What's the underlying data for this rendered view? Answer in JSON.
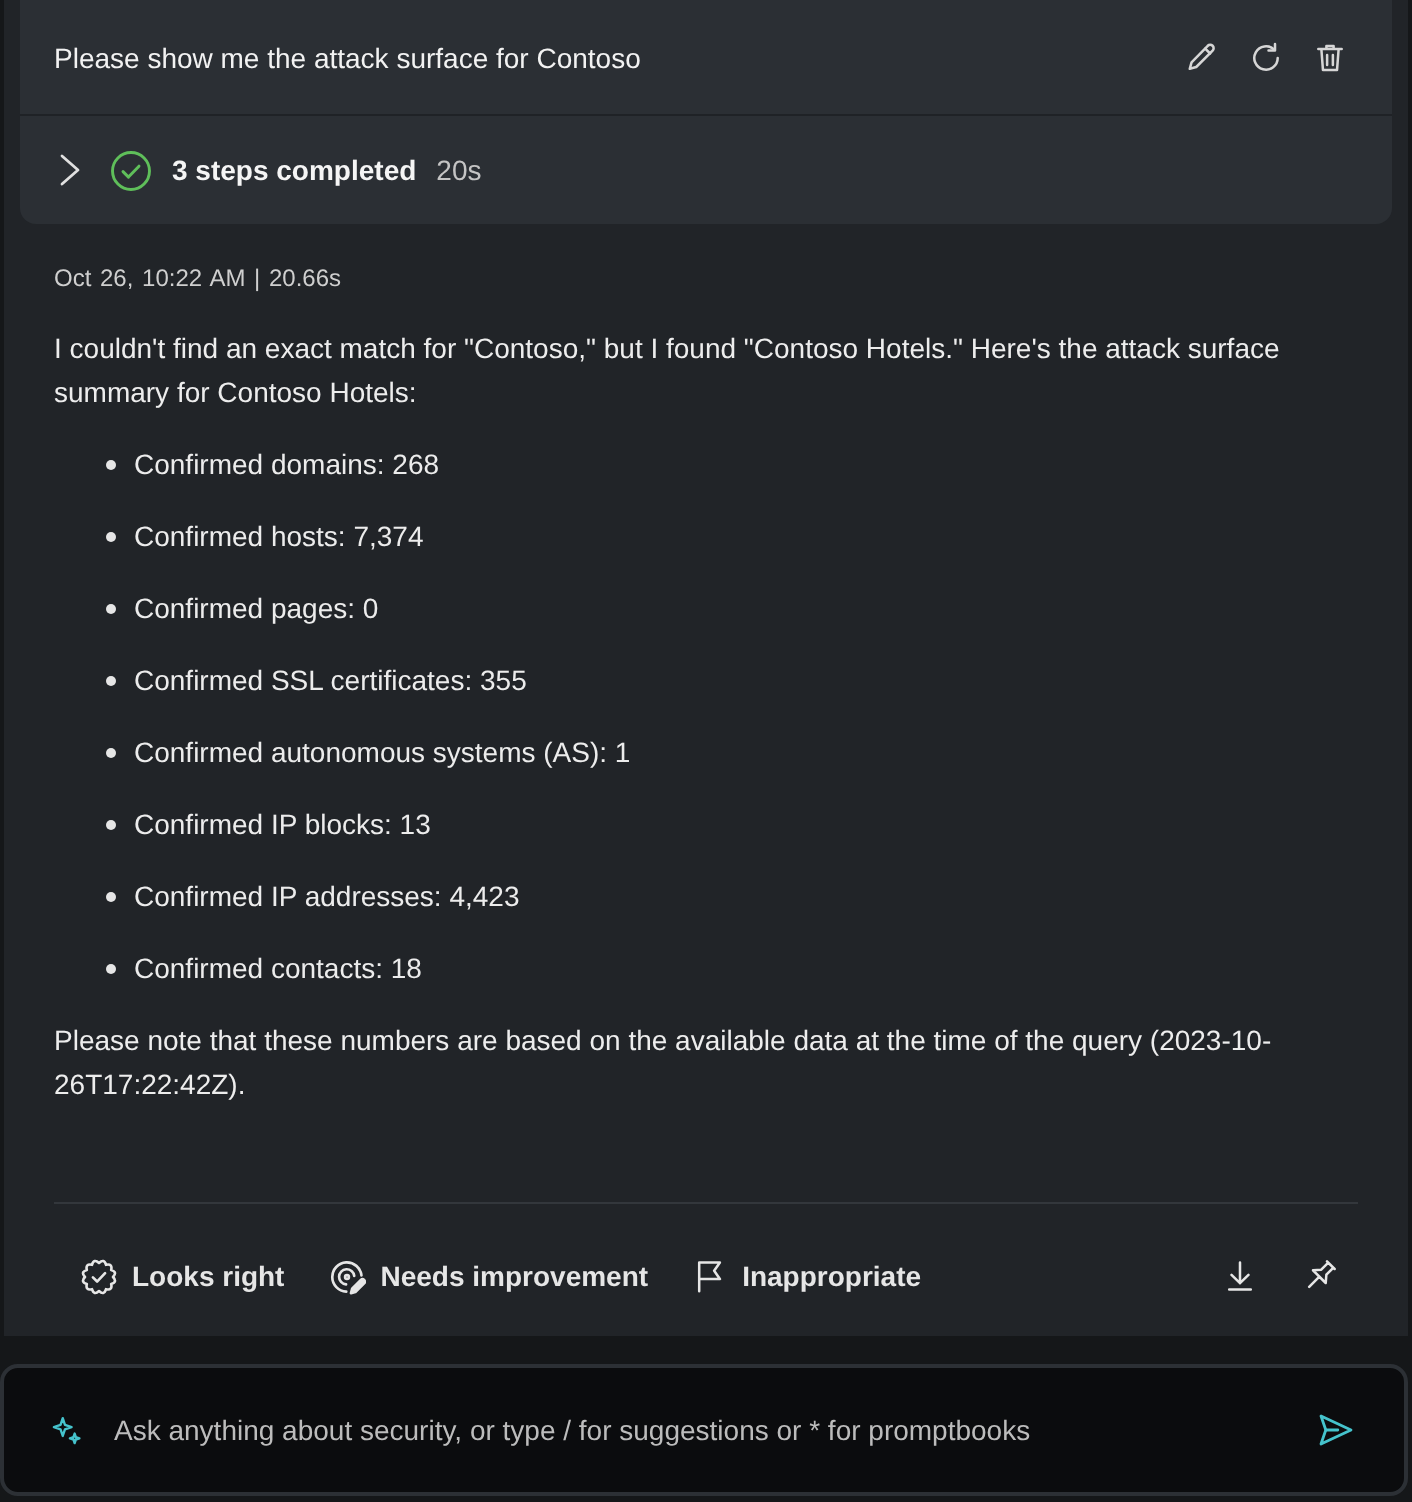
{
  "prompt": {
    "text": "Please show me the attack surface for Contoso"
  },
  "steps": {
    "expanded": false,
    "completed": true,
    "label": "3 steps completed",
    "duration": "20s"
  },
  "response": {
    "meta": "Oct 26, 10:22 AM | 20.66s",
    "intro": "I couldn't find an exact match for \"Contoso,\" but I found \"Contoso Hotels.\" Here's the attack surface summary for Contoso Hotels:",
    "items": [
      "Confirmed domains: 268",
      "Confirmed hosts: 7,374",
      "Confirmed pages: 0",
      "Confirmed SSL certificates: 355",
      "Confirmed autonomous systems (AS): 1",
      "Confirmed IP blocks: 13",
      "Confirmed IP addresses: 4,423",
      "Confirmed contacts: 18"
    ],
    "note": "Please note that these numbers are based on the available data at the time of the query (2023-10-26T17:22:42Z)."
  },
  "feedback": [
    {
      "kind": "approve",
      "label": "Looks right"
    },
    {
      "kind": "improve",
      "label": "Needs improvement"
    },
    {
      "kind": "flag",
      "label": "Inappropriate"
    }
  ],
  "composer": {
    "placeholder": "Ask anything about security, or type / for suggestions or * for promptbooks"
  }
}
